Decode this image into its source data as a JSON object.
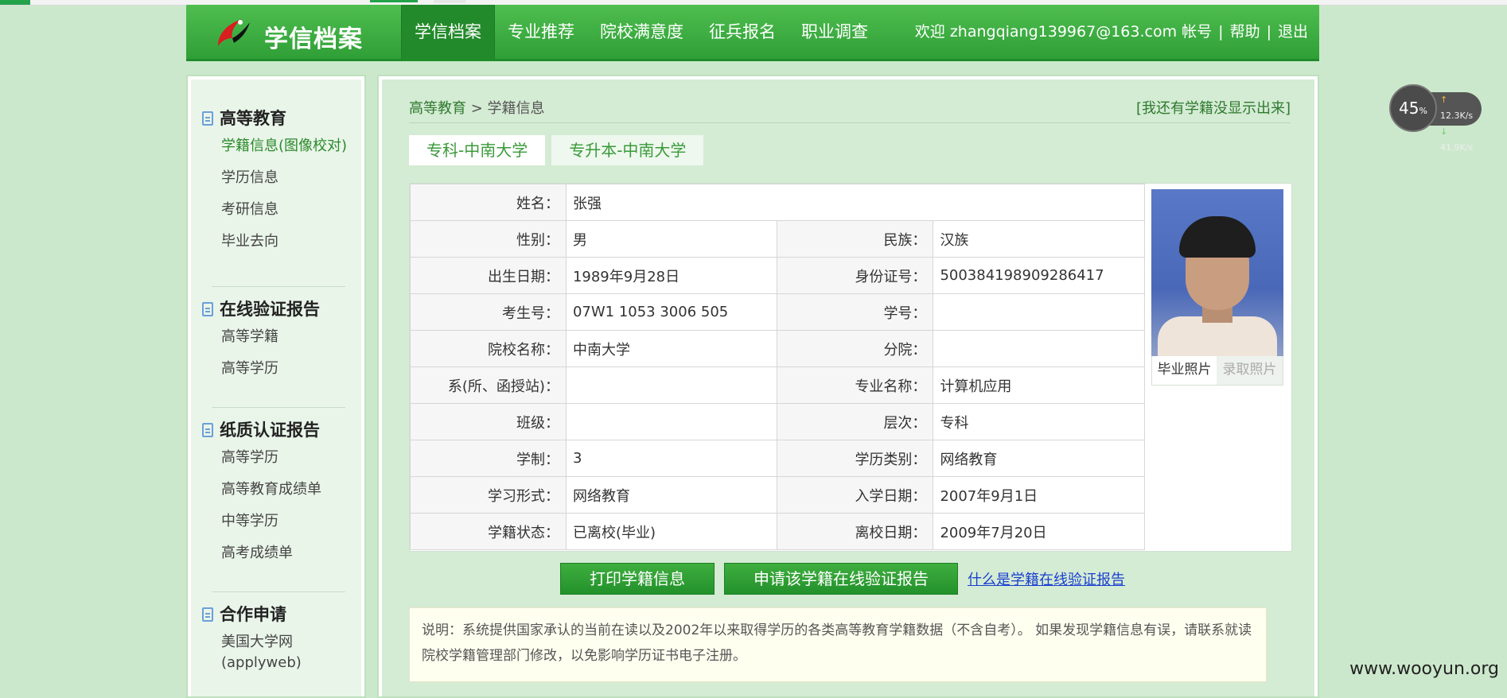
{
  "header": {
    "brand": "学信档案",
    "nav": [
      "学信档案",
      "专业推荐",
      "院校满意度",
      "征兵报名",
      "职业调查"
    ],
    "user_greeting": "欢迎 zhangqiang139967@163.com",
    "account": "帐号",
    "help": "帮助",
    "logout": "退出"
  },
  "sidebar": {
    "sections": [
      {
        "title": "高等教育",
        "items": [
          "学籍信息(图像校对)",
          "学历信息",
          "考研信息",
          "毕业去向"
        ]
      },
      {
        "title": "在线验证报告",
        "items": [
          "高等学籍",
          "高等学历"
        ]
      },
      {
        "title": "纸质认证报告",
        "items": [
          "高等学历",
          "高等教育成绩单",
          "中等学历",
          "高考成绩单"
        ]
      },
      {
        "title": "合作申请",
        "items": [
          "美国大学网",
          "(applyweb)"
        ]
      }
    ]
  },
  "main": {
    "breadcrumb": {
      "parent": "高等教育",
      "sep": " > ",
      "current": "学籍信息"
    },
    "right_link": "[我还有学籍没显示出来]",
    "tabs": [
      "专科-中南大学",
      "专升本-中南大学"
    ],
    "rows": [
      {
        "l1": "姓名：",
        "v1": "张强"
      },
      {
        "l1": "性别：",
        "v1": "男",
        "l2": "民族：",
        "v2": "汉族"
      },
      {
        "l1": "出生日期：",
        "v1": "1989年9月28日",
        "l2": "身份证号：",
        "v2": "500384198909286417"
      },
      {
        "l1": "考生号：",
        "v1": "07W1 1053 3006 505",
        "l2": "学号：",
        "v2": ""
      },
      {
        "l1": "院校名称：",
        "v1": "中南大学",
        "l2": "分院：",
        "v2": ""
      },
      {
        "l1": "系(所、函授站)：",
        "v1": "",
        "l2": "专业名称：",
        "v2": "计算机应用"
      },
      {
        "l1": "班级：",
        "v1": "",
        "l2": "层次：",
        "v2": "专科"
      },
      {
        "l1": "学制：",
        "v1": "3",
        "l2": "学历类别：",
        "v2": "网络教育"
      },
      {
        "l1": "学习形式：",
        "v1": "网络教育",
        "l2": "入学日期：",
        "v2": "2007年9月1日"
      },
      {
        "l1": "学籍状态：",
        "v1": "已离校(毕业)",
        "l2": "离校日期：",
        "v2": "2009年7月20日"
      }
    ],
    "photo_caption": "毕业照片",
    "photo_action": "录取照片",
    "print_button": "打印学籍信息",
    "apply_button": "申请该学籍在线验证报告",
    "what_link": "什么是学籍在线验证报告",
    "note": "说明：系统提供国家承认的当前在读以及2002年以来取得学历的各类高等教育学籍数据（不含自考）。 如果发现学籍信息有误，请联系就读院校学籍管理部门修改，以免影响学历证书电子注册。"
  },
  "speed_widget": {
    "percent": "45",
    "percent_unit": "%",
    "up": "12.3K/s",
    "down": "41.9K/s"
  },
  "watermark": "www.wooyun.org"
}
